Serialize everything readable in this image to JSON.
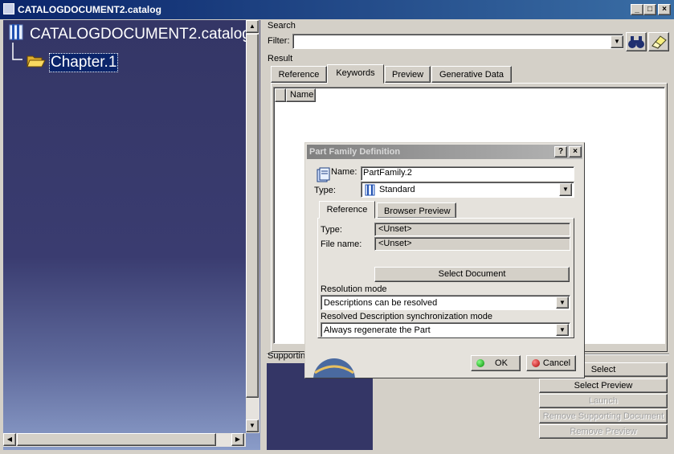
{
  "window": {
    "title": "CATALOGDOCUMENT2.catalog",
    "controls": [
      "_",
      "□",
      "×"
    ]
  },
  "tree": {
    "root_label": "CATALOGDOCUMENT2.catalog",
    "child_label": "Chapter.1"
  },
  "search": {
    "section_label": "Search",
    "filter_label": "Filter:",
    "filter_value": ""
  },
  "result": {
    "section_label": "Result",
    "tabs": [
      "Reference",
      "Keywords",
      "Preview",
      "Generative Data"
    ],
    "active_tab": "Keywords",
    "column_header": "Name"
  },
  "supporting": {
    "label": "Supporting"
  },
  "actions": {
    "select": "Select",
    "select_preview": "Select Preview",
    "launch": "Launch",
    "remove_supporting": "Remove Supporting Document",
    "remove_preview": "Remove Preview"
  },
  "dialog": {
    "title": "Part Family Definition",
    "help": "?",
    "close": "×",
    "name_label": "Name:",
    "name_value": "PartFamily.2",
    "type_label": "Type:",
    "type_value": "Standard",
    "tabs": [
      "Reference",
      "Browser Preview"
    ],
    "ref_type_label": "Type:",
    "ref_type_value": "<Unset>",
    "file_name_label": "File name:",
    "file_name_value": "<Unset>",
    "select_document": "Select Document",
    "resolution_label": "Resolution mode",
    "resolution_value": "Descriptions can be resolved",
    "sync_label": "Resolved Description synchronization mode",
    "sync_value": "Always regenerate the Part",
    "ok": "OK",
    "cancel": "Cancel"
  },
  "colors": {
    "title_active": "#0a246a",
    "title_inactive": "#808080",
    "tree_bg": "#343666",
    "selection": "#0a246a",
    "dialog_bg": "#e5e2dc"
  }
}
